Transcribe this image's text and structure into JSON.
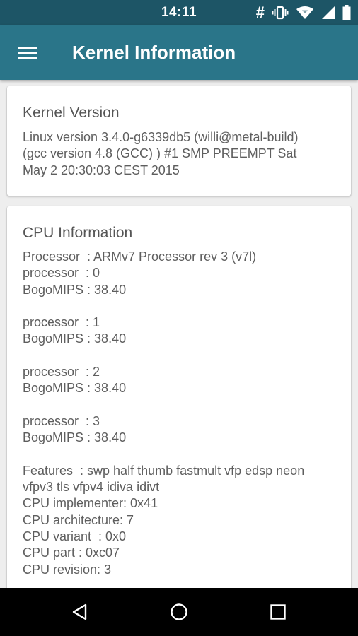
{
  "status_bar": {
    "time": "14:11",
    "icons": [
      "hash-icon",
      "vibrate-icon",
      "wifi-icon",
      "signal-icon",
      "battery-icon"
    ],
    "hash_glyph": "#"
  },
  "app_bar": {
    "title": "Kernel Information",
    "menu_icon": "hamburger-menu-icon",
    "background_color": "#2a7589"
  },
  "kernel_card": {
    "title": "Kernel Version",
    "body": "Linux version 3.4.0-g6339db5 (willi@metal-build)\n(gcc version 4.8 (GCC) ) #1 SMP PREEMPT Sat\nMay 2 20:30:03 CEST 2015"
  },
  "cpu_card": {
    "title": "CPU Information",
    "body": "Processor  : ARMv7 Processor rev 3 (v7l)\nprocessor  : 0\nBogoMIPS : 38.40\n\nprocessor  : 1\nBogoMIPS : 38.40\n\nprocessor  : 2\nBogoMIPS : 38.40\n\nprocessor  : 3\nBogoMIPS : 38.40\n\nFeatures  : swp half thumb fastmult vfp edsp neon\nvfpv3 tls vfpv4 idiva idivt\nCPU implementer: 0x41\nCPU architecture: 7\nCPU variant  : 0x0\nCPU part : 0xc07\nCPU revision: 3"
  },
  "nav_bar": {
    "buttons": [
      "back-icon",
      "home-icon",
      "recents-icon"
    ]
  }
}
